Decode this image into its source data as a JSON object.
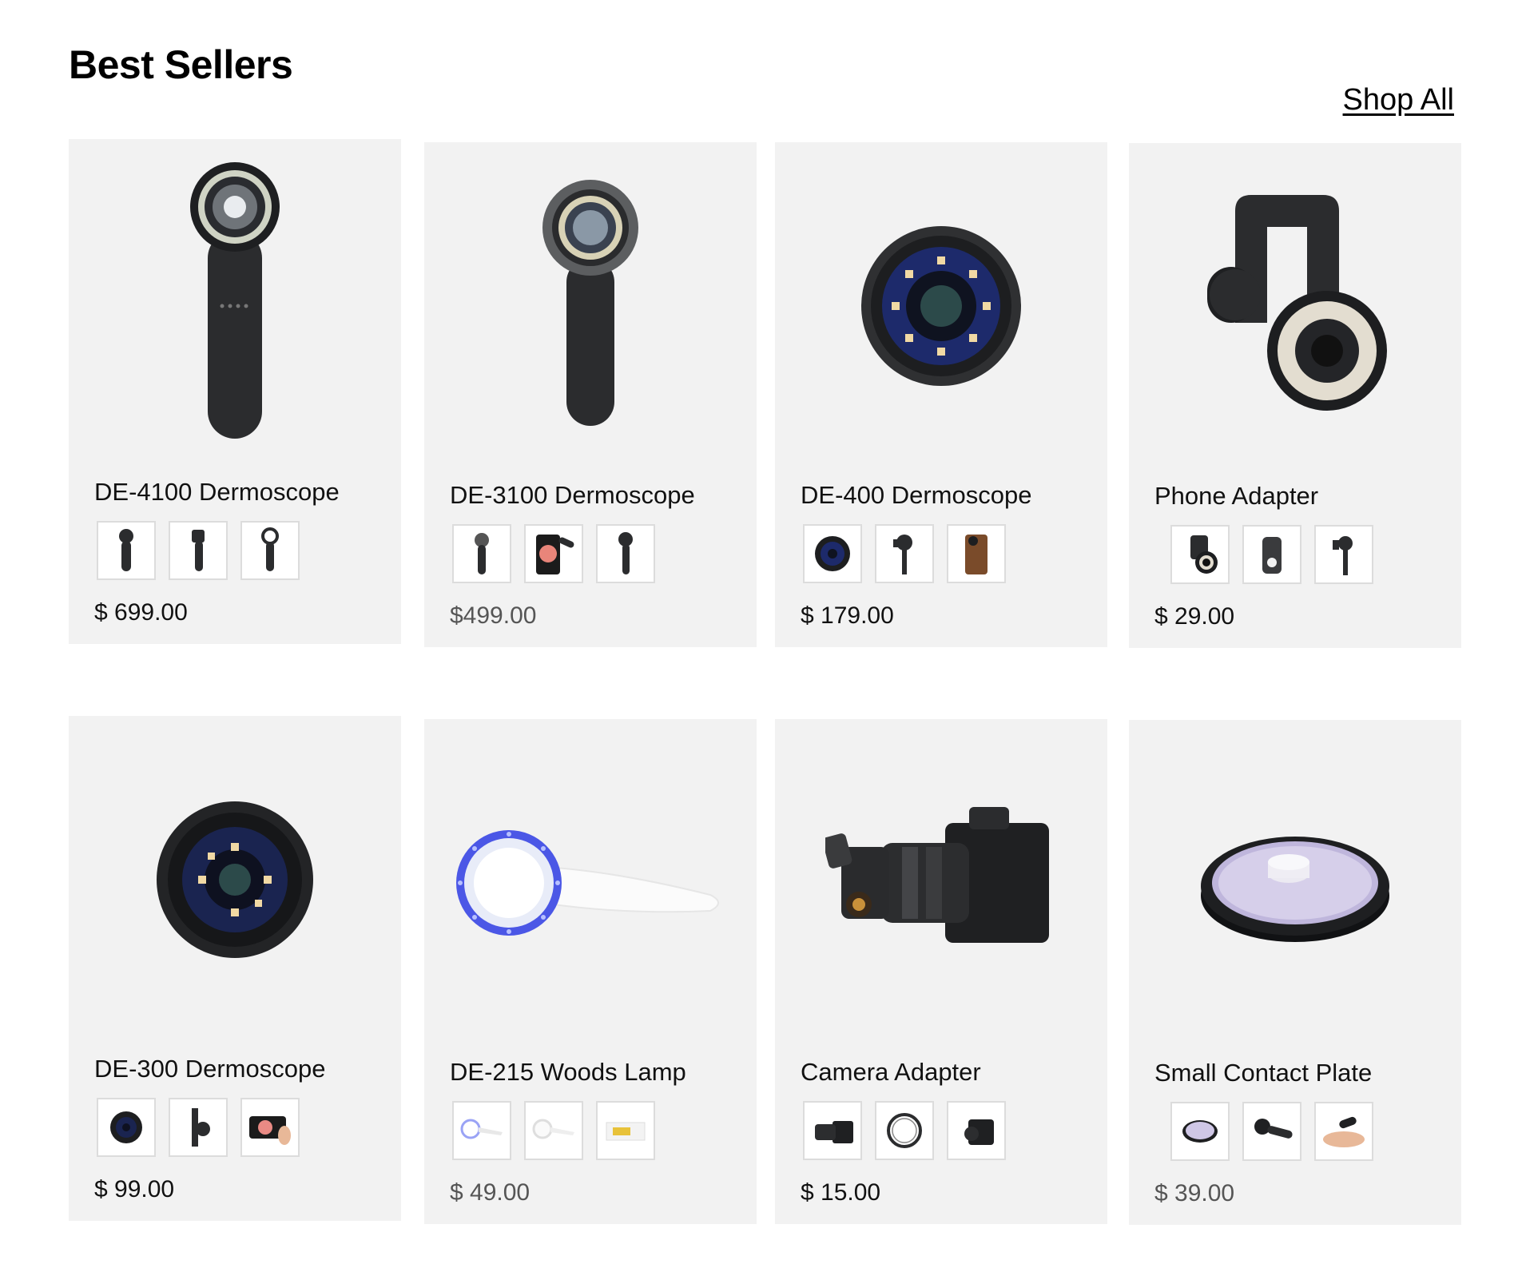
{
  "section": {
    "title": "Best Sellers",
    "shop_all_label": "Shop All"
  },
  "products": [
    {
      "name": "DE-4100 Dermoscope",
      "price": "$ 699.00",
      "image_icon": "handheld-dermoscope-icon",
      "thumbnails": [
        "dermoscope-front-thumb",
        "dermoscope-side-thumb",
        "dermoscope-back-thumb"
      ]
    },
    {
      "name": "DE-3100 Dermoscope",
      "price": "$499.00",
      "image_icon": "handheld-dermoscope-icon",
      "thumbnails": [
        "dermoscope-front-thumb",
        "phone-skin-image-thumb",
        "dermoscope-angled-thumb"
      ]
    },
    {
      "name": "DE-400 Dermoscope",
      "price": "$ 179.00",
      "image_icon": "lens-ring-light-icon",
      "thumbnails": [
        "lens-front-thumb",
        "lens-on-clip-thumb",
        "lens-on-phone-thumb"
      ]
    },
    {
      "name": "Phone Adapter",
      "price": "$ 29.00",
      "image_icon": "phone-clip-adapter-icon",
      "thumbnails": [
        "adapter-with-lens-thumb",
        "adapter-plate-thumb",
        "adapter-clip-thumb"
      ]
    },
    {
      "name": "DE-300 Dermoscope",
      "price": "$ 99.00",
      "image_icon": "lens-ring-light-icon",
      "thumbnails": [
        "lens-front-thumb",
        "lens-on-clip-thumb",
        "phone-skin-image-thumb"
      ]
    },
    {
      "name": "DE-215 Woods Lamp",
      "price": "$ 49.00",
      "image_icon": "woods-lamp-icon",
      "thumbnails": [
        "woods-lamp-uv-thumb",
        "woods-lamp-white-thumb",
        "woods-lamp-box-thumb"
      ]
    },
    {
      "name": "Camera Adapter",
      "price": "$ 15.00",
      "image_icon": "camera-with-adapter-icon",
      "thumbnails": [
        "camera-adapter-thumb",
        "adapter-ring-thumb",
        "camera-body-thumb"
      ]
    },
    {
      "name": "Small Contact Plate",
      "price": "$ 39.00",
      "image_icon": "contact-plate-icon",
      "thumbnails": [
        "contact-plate-thumb",
        "plate-on-dermoscope-thumb",
        "plate-in-use-thumb"
      ]
    }
  ],
  "colors": {
    "card_background": "#f2f2f2",
    "device_dark": "#2b2c2e",
    "accent_uv": "#4b57e6",
    "price_muted": "#555555"
  }
}
